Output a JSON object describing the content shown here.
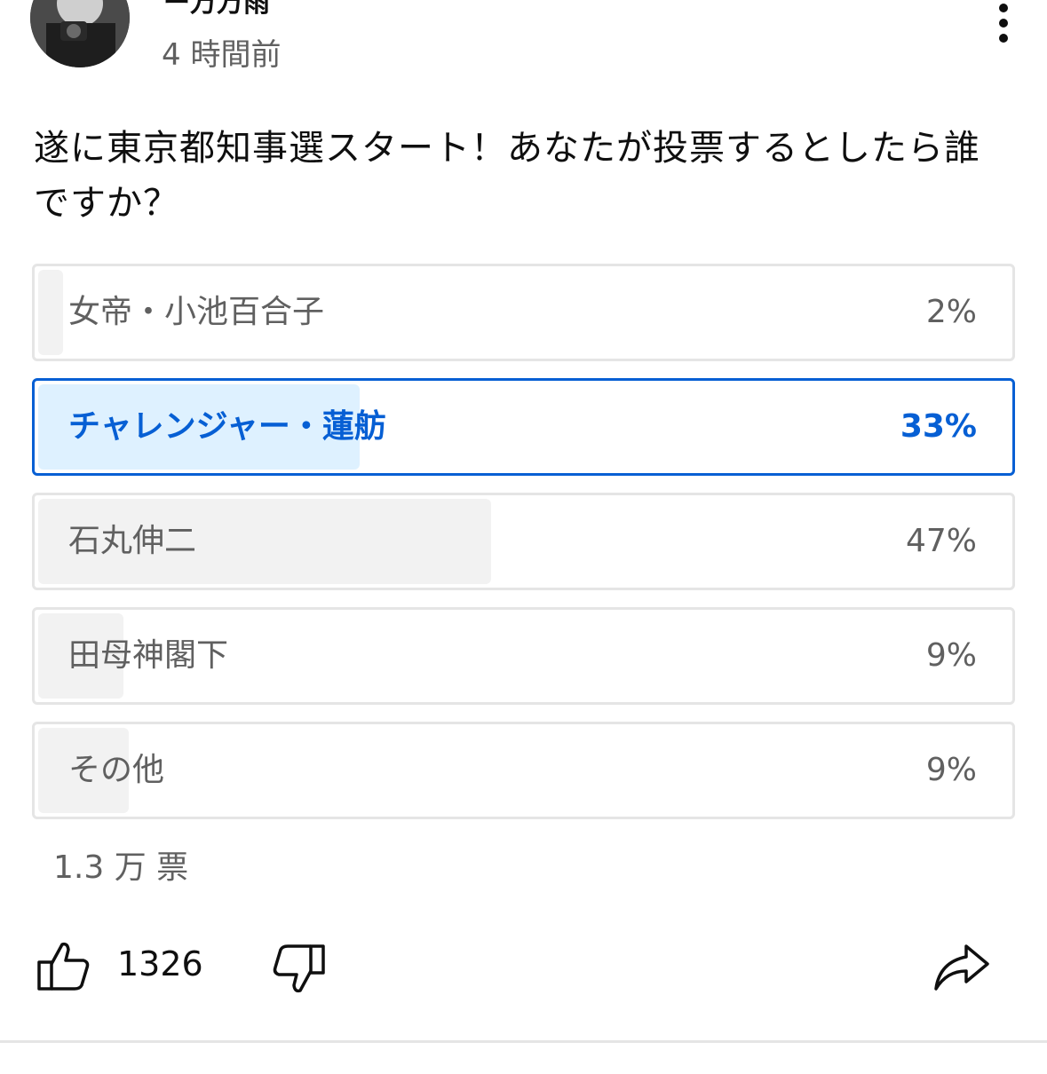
{
  "post": {
    "author": "ー万万雨",
    "time": "4 時間前",
    "question": "遂に東京都知事選スタート！あなたが投票するとしたら誰ですか？"
  },
  "poll": {
    "options": [
      {
        "label": "女帝・小池百合子",
        "percent_text": "2%",
        "percent": 2,
        "selected": false
      },
      {
        "label": "チャレンジャー・蓮舫",
        "percent_text": "33%",
        "percent": 33,
        "selected": true
      },
      {
        "label": "石丸伸二",
        "percent_text": "47%",
        "percent": 47,
        "selected": false
      },
      {
        "label": "田母神閣下",
        "percent_text": "9%",
        "percent": 9,
        "selected": false
      },
      {
        "label": "その他",
        "percent_text": "9%",
        "percent": 9,
        "selected": false
      }
    ],
    "votes": "1.3 万 票"
  },
  "actions": {
    "like_count": "1326",
    "icons": [
      "thumb-up-icon",
      "thumb-down-icon",
      "share-icon",
      "more-vert-icon"
    ]
  },
  "colors": {
    "accent": "#065fd4",
    "selected_fill": "#def1ff",
    "option_fill": "#f2f2f2",
    "border": "#e5e5e5",
    "muted_text": "#606060"
  }
}
